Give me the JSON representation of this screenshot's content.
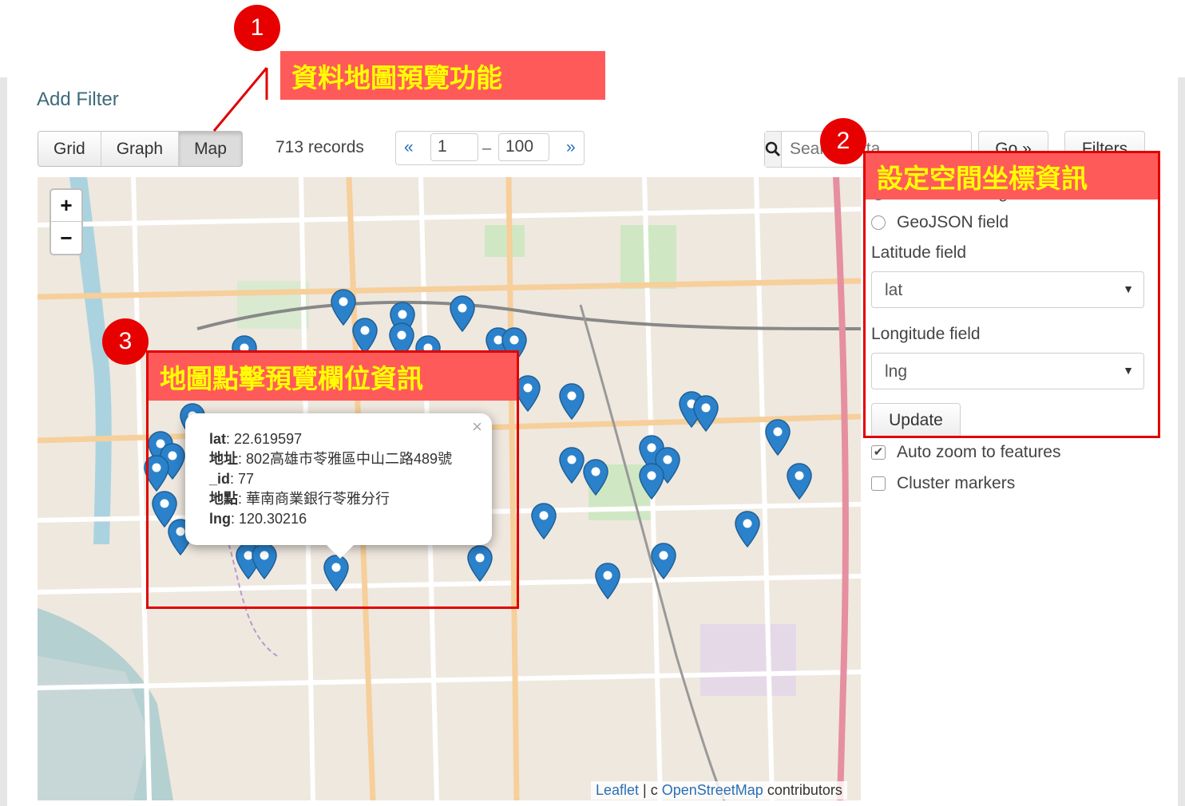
{
  "header": {
    "add_filter": "Add Filter"
  },
  "views": {
    "grid": "Grid",
    "graph": "Graph",
    "map": "Map",
    "active": "Map"
  },
  "records": "713 records",
  "pager": {
    "prev": "«",
    "from": "1",
    "to": "100",
    "next": "»"
  },
  "search": {
    "placeholder": "Search data...",
    "go": "Go »",
    "filters": "Filters"
  },
  "map": {
    "zoom_in": "+",
    "zoom_out": "−",
    "attribution": {
      "leaflet": "Leaflet",
      "sep": " | c ",
      "osm": "OpenStreetMap",
      "suffix": " contributors"
    },
    "marker_color": "#2b82cb"
  },
  "popup": {
    "close": "×",
    "rows": [
      {
        "key": "lat",
        "value": ": 22.619597"
      },
      {
        "key": "地址",
        "value": ": 802高雄市苓雅區中山二路489號"
      },
      {
        "key": "_id",
        "value": ": 77"
      },
      {
        "key": "地點",
        "value": ": 華南商業銀行苓雅分行"
      },
      {
        "key": "lng",
        "value": ": 120.30216"
      }
    ]
  },
  "settings": {
    "option_latlng": "Latitude / Longitude fields",
    "option_geojson": "GeoJSON field",
    "lat_label": "Latitude field",
    "lat_value": "lat",
    "lng_label": "Longitude field",
    "lng_value": "lng",
    "update": "Update",
    "auto_zoom": "Auto zoom to features",
    "cluster": "Cluster markers"
  },
  "annotations": {
    "badge1": "1",
    "callout1": "資料地圖預覽功能",
    "badge2": "2",
    "callout2": "設定空間坐標資訊",
    "badge3": "3",
    "callout3": "地圖點擊預覽欄位資訊",
    "color_red": "#e60000",
    "color_yellow": "#ffff00"
  }
}
